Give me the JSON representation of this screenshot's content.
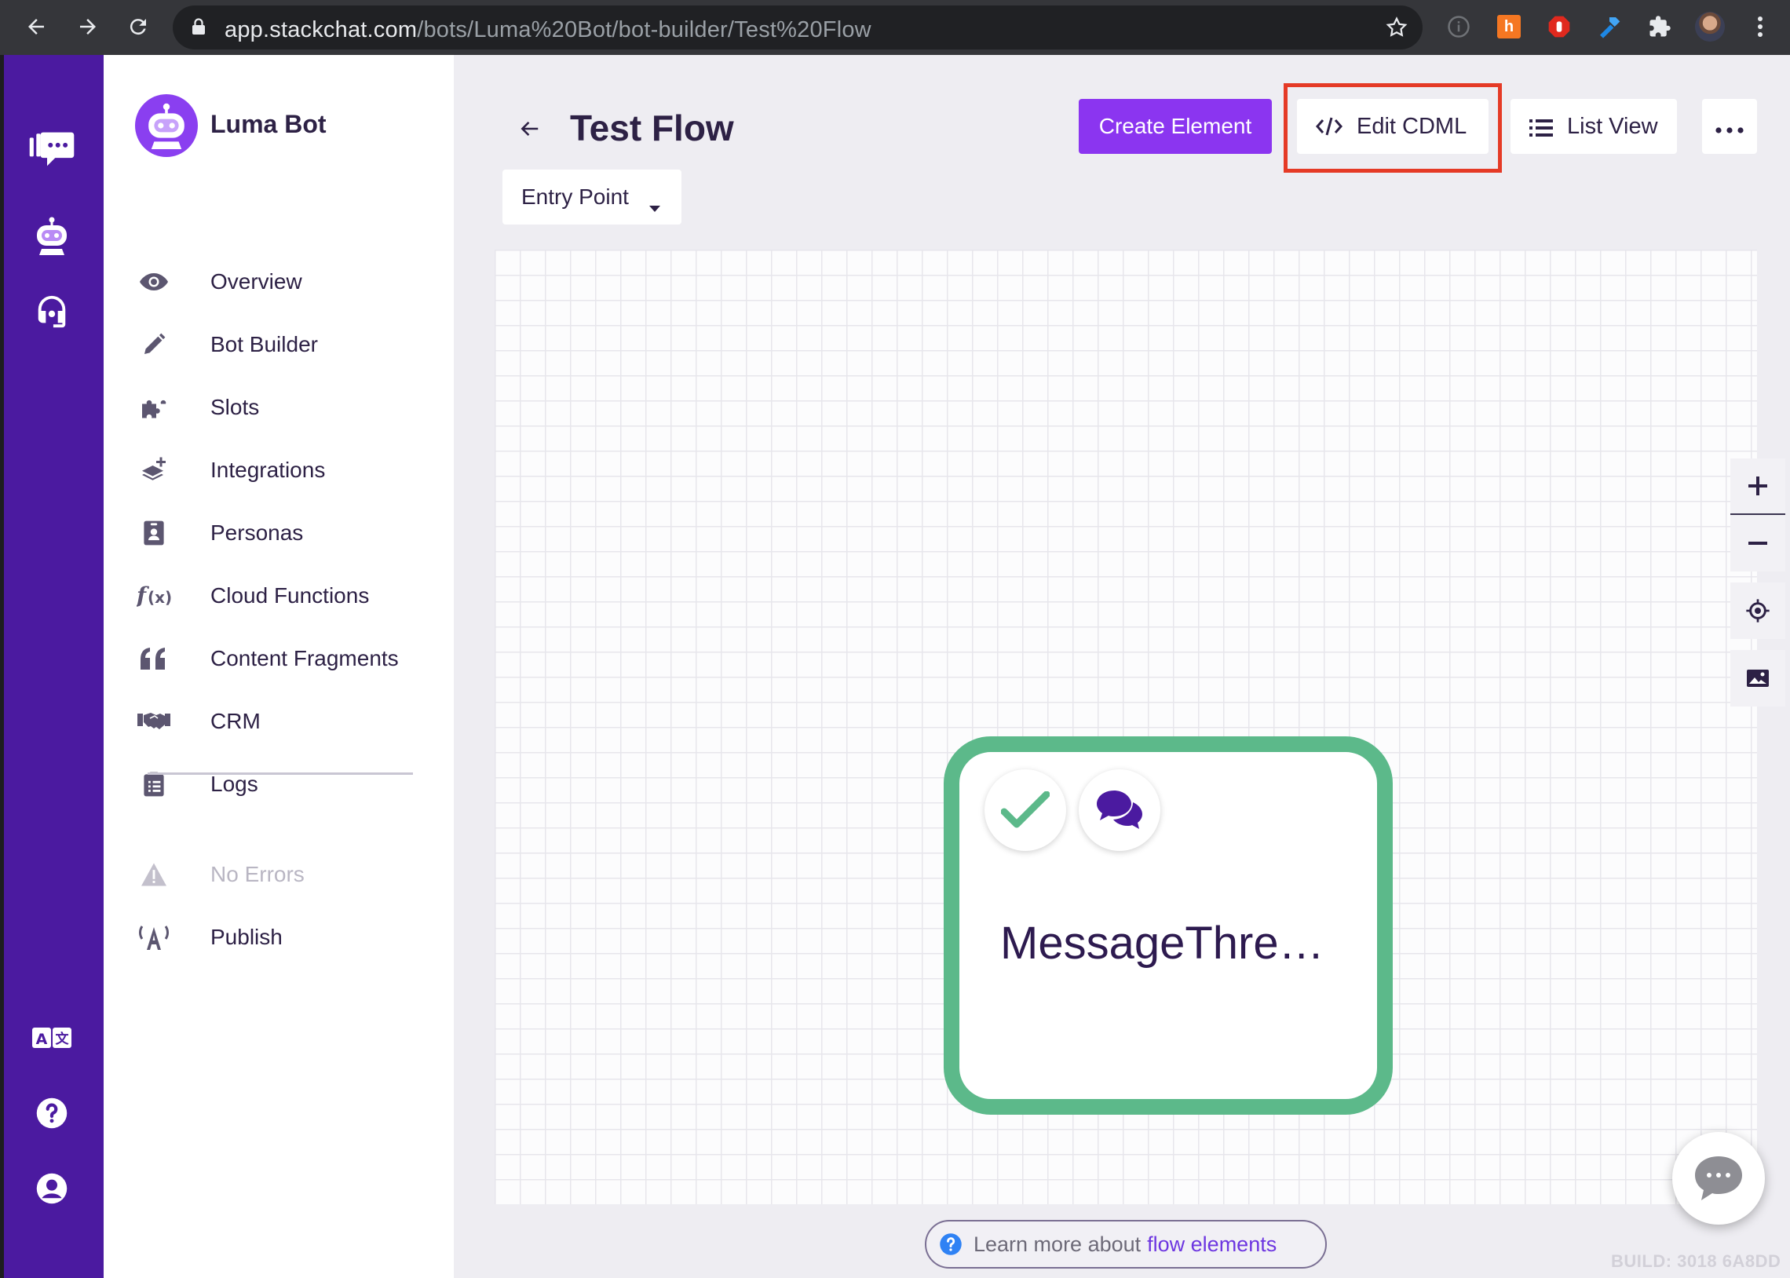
{
  "browser": {
    "url_host": "app.stackchat.com",
    "url_path": "/bots/Luma%20Bot/bot-builder/Test%20Flow"
  },
  "rail": {
    "icons": [
      "stackchat-logo-icon",
      "bot-icon",
      "headset-icon",
      "translate-icon",
      "help-icon",
      "account-icon"
    ]
  },
  "sidebar": {
    "bot_name": "Luma Bot",
    "items": [
      {
        "label": "Overview",
        "icon": "eye-icon"
      },
      {
        "label": "Bot Builder",
        "icon": "pencil-icon"
      },
      {
        "label": "Slots",
        "icon": "puzzle-icon"
      },
      {
        "label": "Integrations",
        "icon": "layers-plus-icon"
      },
      {
        "label": "Personas",
        "icon": "id-badge-icon"
      },
      {
        "label": "Cloud Functions",
        "icon": "function-icon"
      },
      {
        "label": "Content Fragments",
        "icon": "quote-icon"
      },
      {
        "label": "CRM",
        "icon": "handshake-icon"
      },
      {
        "label": "Logs",
        "icon": "clipboard-icon"
      }
    ],
    "status": {
      "label": "No Errors",
      "icon": "warning-icon"
    },
    "publish": {
      "label": "Publish",
      "icon": "broadcast-icon"
    }
  },
  "header": {
    "title": "Test Flow",
    "create_label": "Create Element",
    "edit_cdml_label": "Edit CDML",
    "list_view_label": "List View",
    "dropdown_label": "Entry Point"
  },
  "node": {
    "title": "MessageThre…",
    "border_color": "#5cb98a"
  },
  "footer": {
    "learn_prefix": "Learn more about",
    "learn_link": "flow elements",
    "build": "BUILD: 3018 6A8DD"
  },
  "colors": {
    "accent": "#8b35f0",
    "rail": "#4b1aa0",
    "highlight": "#e53a26"
  }
}
